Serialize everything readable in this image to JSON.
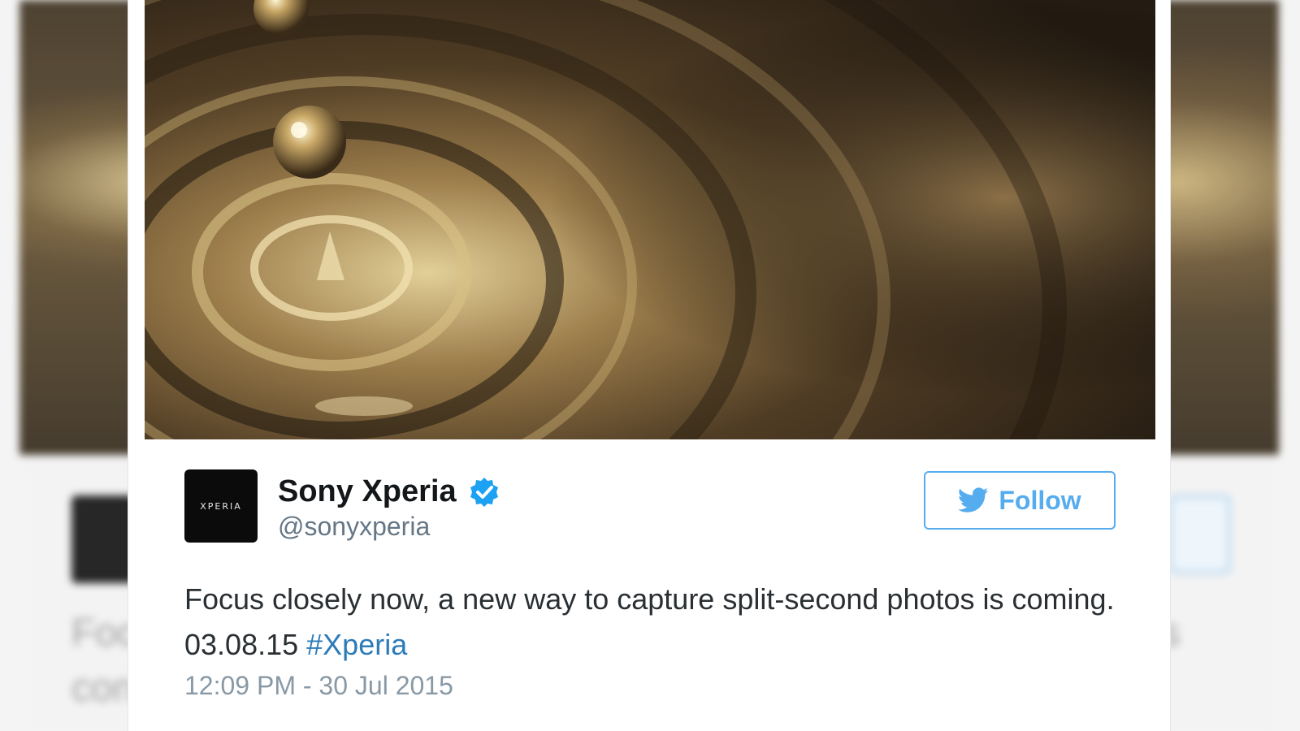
{
  "tweet": {
    "avatar_text": "XPERIA",
    "display_name": "Sony Xperia",
    "handle": "@sonyxperia",
    "verified": true,
    "follow_label": "Follow",
    "text_main": "Focus closely now, a new way to capture split-second photos is coming. 03.08.15 ",
    "hashtag": "#Xperia",
    "timestamp": "12:09 PM - 30 Jul 2015"
  },
  "background_copy": {
    "text_line1": "Foc",
    "text_line2": "con",
    "text_right": "is"
  },
  "colors": {
    "brand_blue": "#55acee",
    "link_blue": "#2b7bb9",
    "verified_blue": "#1da1f2",
    "photo_gold": "#c9a867"
  },
  "icons": {
    "verified": "verified-badge-icon",
    "follow": "twitter-bird-icon"
  }
}
